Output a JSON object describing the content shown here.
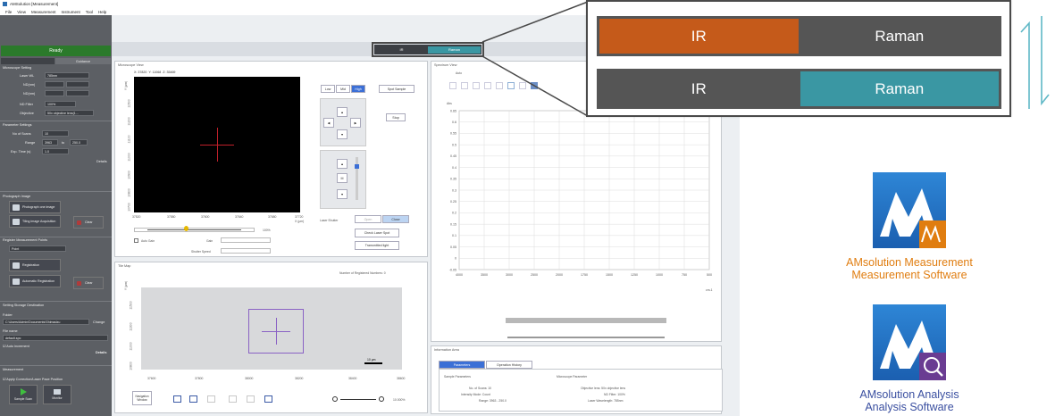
{
  "app": {
    "window_title": "AMSolution [Measurement]",
    "menu": [
      "File",
      "View",
      "Measurement",
      "Instrument",
      "Tool",
      "Help"
    ],
    "status": "Ready",
    "mode_toggle": {
      "left": "IR",
      "right": "Raman",
      "selected": "Raman"
    }
  },
  "sidebar": {
    "tabs": [
      "",
      "Guidance"
    ],
    "microscope_setting": {
      "title": "Microscope Setting",
      "rows": [
        {
          "label": "Laser WL",
          "value": "785nm"
        },
        {
          "label": "ND(nm)",
          "value": ""
        },
        {
          "label": "ND(nm)",
          "value": ""
        },
        {
          "label": "ND Filter",
          "value": "100%"
        },
        {
          "label": "Objective",
          "value": "50x objective lens(1..."
        }
      ]
    },
    "parameter_settings": {
      "title": "Parameter Settings",
      "rows": [
        {
          "label": "No of Scans",
          "value": "10"
        },
        {
          "label": "Range",
          "value": "3963",
          "to_label": "to",
          "to_value": "250.0"
        },
        {
          "label": "Exp. Time (s)",
          "value": "1.0"
        }
      ],
      "details": "Details"
    },
    "photograph_image": {
      "title": "Photograph Image",
      "buttons": [
        "Photograph one image",
        "Tiling image Acquisition"
      ],
      "clear": "Clear"
    },
    "register_measurement_points": {
      "title": "Register Measurement Points",
      "type": "Point",
      "buttons": [
        "Registration",
        "Automatic Registration"
      ],
      "clear": "Clear"
    },
    "data_storage": {
      "title": "Setting Storage Destination",
      "folder_label": "Folder",
      "folder_value": "C:\\Users\\Admin\\Documents\\Shimadzu",
      "change": "Change",
      "filename_label": "File name",
      "filename_value": "default.spc",
      "auto_increment": "Auto increment",
      "details": "Details"
    },
    "measurement": {
      "title": "Measurement",
      "apply_option": "Apply Correction/Laser Pace Position",
      "buttons": [
        "Sample Scan",
        "Monitor"
      ]
    }
  },
  "microscope_view": {
    "title": "Microscope View",
    "coords": [
      "X: 37820",
      "Y: 11068",
      "Z: 35469"
    ],
    "y_unit": "Y (μm)",
    "y_ticks": [
      "11500",
      "11200",
      "11100",
      "11000",
      "10900",
      "10800",
      "10700"
    ],
    "x_ticks": [
      "37520",
      "37580",
      "37600",
      "37640",
      "37680",
      "37720"
    ],
    "x_unit": "X (μm)",
    "brightness_percent": "100%",
    "auto_gain": "Auto Gain",
    "gain_label": "Gain",
    "shutter_label": "Shutter Speed",
    "zoom": [
      "Low",
      "Mid",
      "High"
    ],
    "spot_sample": "Spot Sample",
    "stop": "Stop",
    "laser_shutter": "Laser Shutter",
    "open": "Open",
    "close": "Close",
    "check_laser": "Check Laser Spot",
    "transmitted_light": "Transmitted light"
  },
  "tile_map": {
    "title": "Tile Map",
    "registered": "Number of Registered Numbers: 0",
    "y_unit": "Y (μm)",
    "y_ticks": [
      "11500",
      "11300",
      "11000",
      "10800",
      "10600"
    ],
    "x_ticks": [
      "37600",
      "37800",
      "38000",
      "38200",
      "38400",
      "38600"
    ],
    "scale_bar": "10 μm",
    "navigation": "Navigation Window",
    "zoom_pct": "10.000%"
  },
  "spectrum_view": {
    "title": "Spectrum View",
    "auto_label": "Auto",
    "y_label": "Abs",
    "x_label": "cm-1"
  },
  "information": {
    "title": "Information Area",
    "tabs": [
      "Parameters",
      "Operation History"
    ],
    "sample_params_title": "Sample Parameters",
    "sample_params": [
      "No. of Scans: 10",
      "Intensity Mode: Count",
      "Range: 3963 - 250.0"
    ],
    "microscope_params_title": "Microscope Parameter",
    "microscope_params": [
      "Objective lens: 50x objective lens",
      "ND Filter: 100%",
      "Laser Wavelength: 785nm"
    ]
  },
  "chart_data": {
    "type": "line",
    "x_ticks": [
      "4000",
      "3500",
      "3000",
      "2500",
      "2000",
      "1750",
      "1500",
      "1250",
      "1000",
      "750",
      "500"
    ],
    "y_ticks": [
      "0.65",
      "0.6",
      "0.55",
      "0.5",
      "0.45",
      "0.4",
      "0.35",
      "0.3",
      "0.25",
      "0.2",
      "0.15",
      "0.1",
      "0.05",
      "0",
      "-0.05"
    ],
    "series": []
  },
  "callout": {
    "rows": [
      {
        "left": "IR",
        "right": "Raman",
        "active": "left",
        "active_color": "#c55a1a"
      },
      {
        "left": "IR",
        "right": "Raman",
        "active": "right",
        "active_color": "#3a97a3"
      }
    ]
  },
  "products": [
    {
      "name_line1": "AMsolution Measurement",
      "name_line2": "Measurement Software",
      "icon": "measurement-app-icon",
      "color": "#e07d10"
    },
    {
      "name_line1": "AMsolution Analysis",
      "name_line2": "Analysis Software",
      "icon": "analysis-app-icon",
      "color": "#3a4fa0"
    }
  ]
}
